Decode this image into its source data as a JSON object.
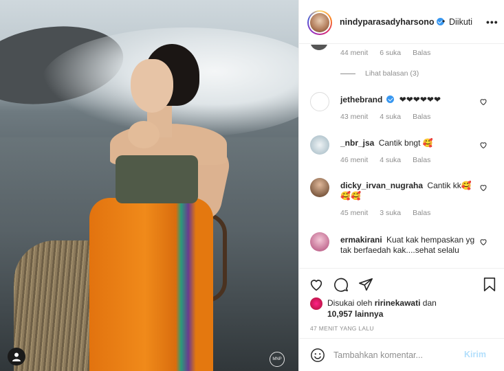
{
  "post": {
    "watermark": "MNP"
  },
  "header": {
    "username": "nindyparasadyharsono",
    "dot": "•",
    "follow_label": "Diikuti",
    "more_label": "•••"
  },
  "comments_top": {
    "time": "44 menit",
    "likes": "6 suka",
    "reply": "Balas",
    "view_replies": "Lihat balasan (3)"
  },
  "comments": [
    {
      "username": "jethebrand",
      "verified": true,
      "text": "❤❤❤❤❤❤",
      "time": "43 menit",
      "likes": "4 suka",
      "reply": "Balas"
    },
    {
      "username": "_nbr_jsa",
      "verified": false,
      "text": "Cantik bngt 🥰",
      "time": "46 menit",
      "likes": "4 suka",
      "reply": "Balas"
    },
    {
      "username": "dicky_irvan_nugraha",
      "verified": false,
      "text": "Cantik kk🥰🥰🥰",
      "time": "45 menit",
      "likes": "3 suka",
      "reply": "Balas"
    },
    {
      "username": "ermakirani",
      "verified": false,
      "text": "Kuat kak hempaskan yg tak berfaedah kak....sehat selalu",
      "time": "",
      "likes": "",
      "reply": ""
    }
  ],
  "likes": {
    "prefix": "Disukai oleh",
    "user": "ririnekawati",
    "and": "dan",
    "count": "10,957 lainnya"
  },
  "timestamp": "47 MENIT YANG LALU",
  "composer": {
    "placeholder": "Tambahkan komentar...",
    "send_label": "Kirim"
  },
  "colors": {
    "accent": "#3897f0",
    "send_disabled": "#b2dffc",
    "muted": "#8e8e8e",
    "text": "#262626"
  },
  "icons": [
    "user-icon",
    "verified-icon",
    "more-icon",
    "heart-icon",
    "comment-icon",
    "share-icon",
    "bookmark-icon",
    "emoji-icon"
  ]
}
